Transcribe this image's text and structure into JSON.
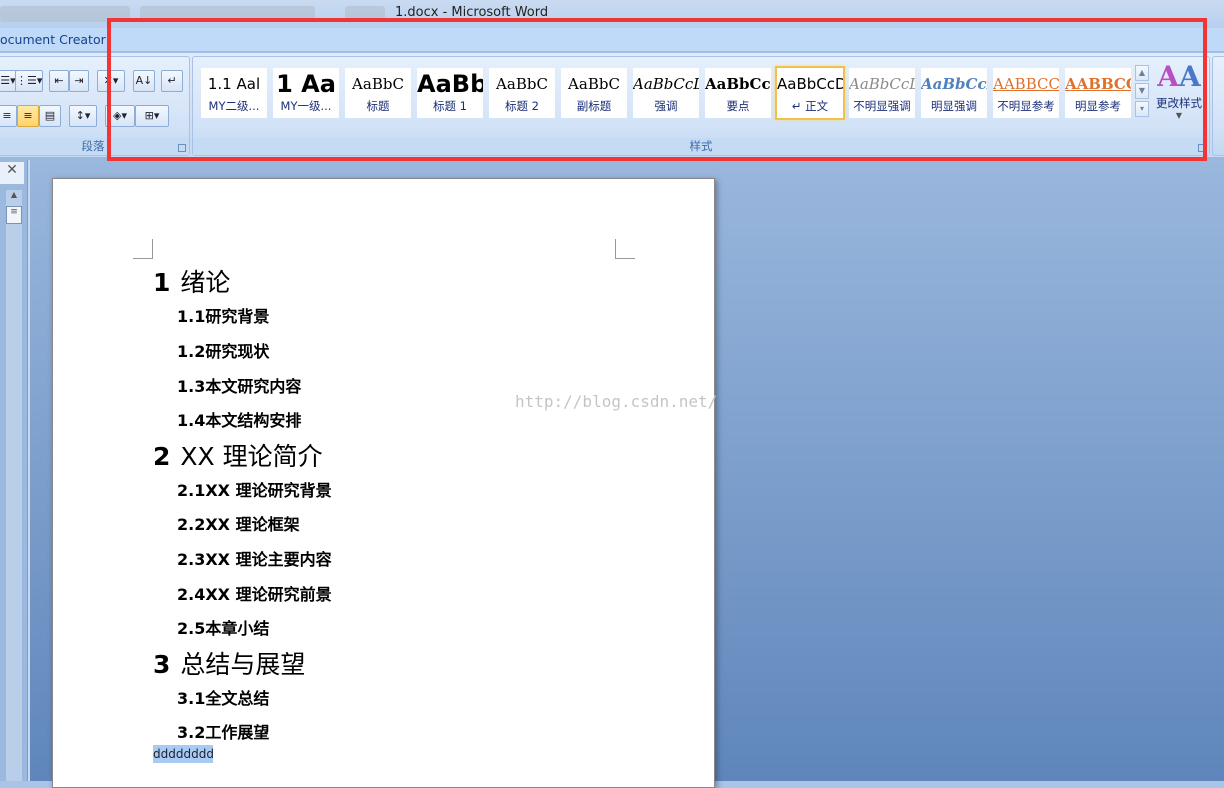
{
  "window": {
    "title": "1.docx - Microsoft Word"
  },
  "ribbon": {
    "tab_partial": "ocument Creator",
    "paragraph_group": {
      "label": "段落"
    },
    "styles_group": {
      "label": "样式",
      "items": [
        {
          "preview": "1.1  Aal",
          "name": "MY二级...",
          "font": "sans",
          "color": "#000",
          "bold": false,
          "italic": false
        },
        {
          "preview": "1  Aa",
          "name": "MY一级...",
          "font": "sans-big",
          "color": "#000",
          "bold": true,
          "italic": false
        },
        {
          "preview": "AaBbC",
          "name": "标题",
          "font": "serif",
          "color": "#000",
          "bold": false,
          "italic": false
        },
        {
          "preview": "AaBb",
          "name": "标题 1",
          "font": "sans-big",
          "color": "#000",
          "bold": true,
          "italic": false
        },
        {
          "preview": "AaBbC",
          "name": "标题 2",
          "font": "serif",
          "color": "#000",
          "bold": false,
          "italic": false
        },
        {
          "preview": "AaBbC",
          "name": "副标题",
          "font": "serif",
          "color": "#000",
          "bold": false,
          "italic": false
        },
        {
          "preview": "AaBbCcDd",
          "name": "强调",
          "font": "serif",
          "color": "#000",
          "bold": false,
          "italic": true
        },
        {
          "preview": "AaBbCcD",
          "name": "要点",
          "font": "serif",
          "color": "#000",
          "bold": true,
          "italic": false
        },
        {
          "preview": "AaBbCcDd",
          "name": "↵ 正文",
          "font": "sans",
          "color": "#000",
          "bold": false,
          "italic": false,
          "selected": true
        },
        {
          "preview": "AaBbCcDd",
          "name": "不明显强调",
          "font": "serif",
          "color": "#8a8a8a",
          "bold": false,
          "italic": true
        },
        {
          "preview": "AaBbCcDd",
          "name": "明显强调",
          "font": "serif",
          "color": "#4f81bd",
          "bold": true,
          "italic": true
        },
        {
          "preview": "AABBCCDD",
          "name": "不明显参考",
          "font": "serif",
          "color": "#e0712c",
          "bold": false,
          "italic": false,
          "underline": true
        },
        {
          "preview": "AABBCCI",
          "name": "明显参考",
          "font": "serif",
          "color": "#e0712c",
          "bold": true,
          "italic": false,
          "underline": true
        }
      ],
      "change_styles_label": "更改样式"
    }
  },
  "document": {
    "lines": [
      {
        "level": 1,
        "num": "1",
        "text": "绪论"
      },
      {
        "level": 2,
        "num": "1.1",
        "text": "研究背景"
      },
      {
        "level": 2,
        "num": "1.2",
        "text": "研究现状"
      },
      {
        "level": 2,
        "num": "1.3",
        "text": "本文研究内容"
      },
      {
        "level": 2,
        "num": "1.4",
        "text": "本文结构安排"
      },
      {
        "level": 1,
        "num": "2",
        "text": "XX 理论简介"
      },
      {
        "level": 2,
        "num": "2.1",
        "text": "XX 理论研究背景"
      },
      {
        "level": 2,
        "num": "2.2",
        "text": "XX 理论框架"
      },
      {
        "level": 2,
        "num": "2.3",
        "text": "XX 理论主要内容"
      },
      {
        "level": 2,
        "num": "2.4",
        "text": "XX 理论研究前景"
      },
      {
        "level": 2,
        "num": "2.5",
        "text": "本章小结"
      },
      {
        "level": 1,
        "num": "3",
        "text": "总结与展望"
      },
      {
        "level": 2,
        "num": "3.1",
        "text": "全文总结"
      },
      {
        "level": 2,
        "num": "3.2",
        "text": "工作展望"
      }
    ],
    "selected_text": "dddddddd",
    "watermark": "http://blog.csdn.net/"
  },
  "colors": {
    "highlight_box": "#f23434",
    "selection": "#a8cbf3"
  }
}
